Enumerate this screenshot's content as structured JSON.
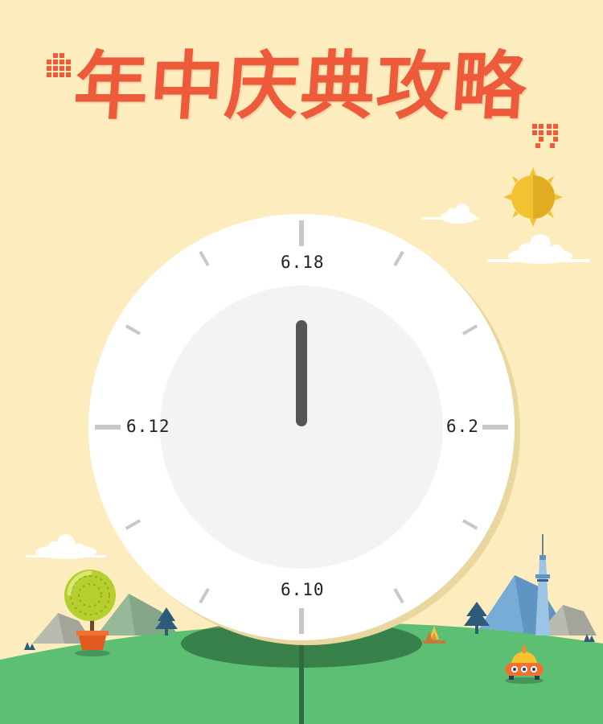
{
  "title": "年中庆典攻略",
  "clock": {
    "top_label": "6.18",
    "right_label": "6.2",
    "bottom_label": "6.10",
    "left_label": "6.12"
  },
  "colors": {
    "background": "#fdedbe",
    "title": "#ee5b3a",
    "sun": "#f2c230",
    "grass": "#5cbf74",
    "clock_face": "#ffffff",
    "clock_inner": "#f3f3f3",
    "clock_hand": "#555555"
  }
}
